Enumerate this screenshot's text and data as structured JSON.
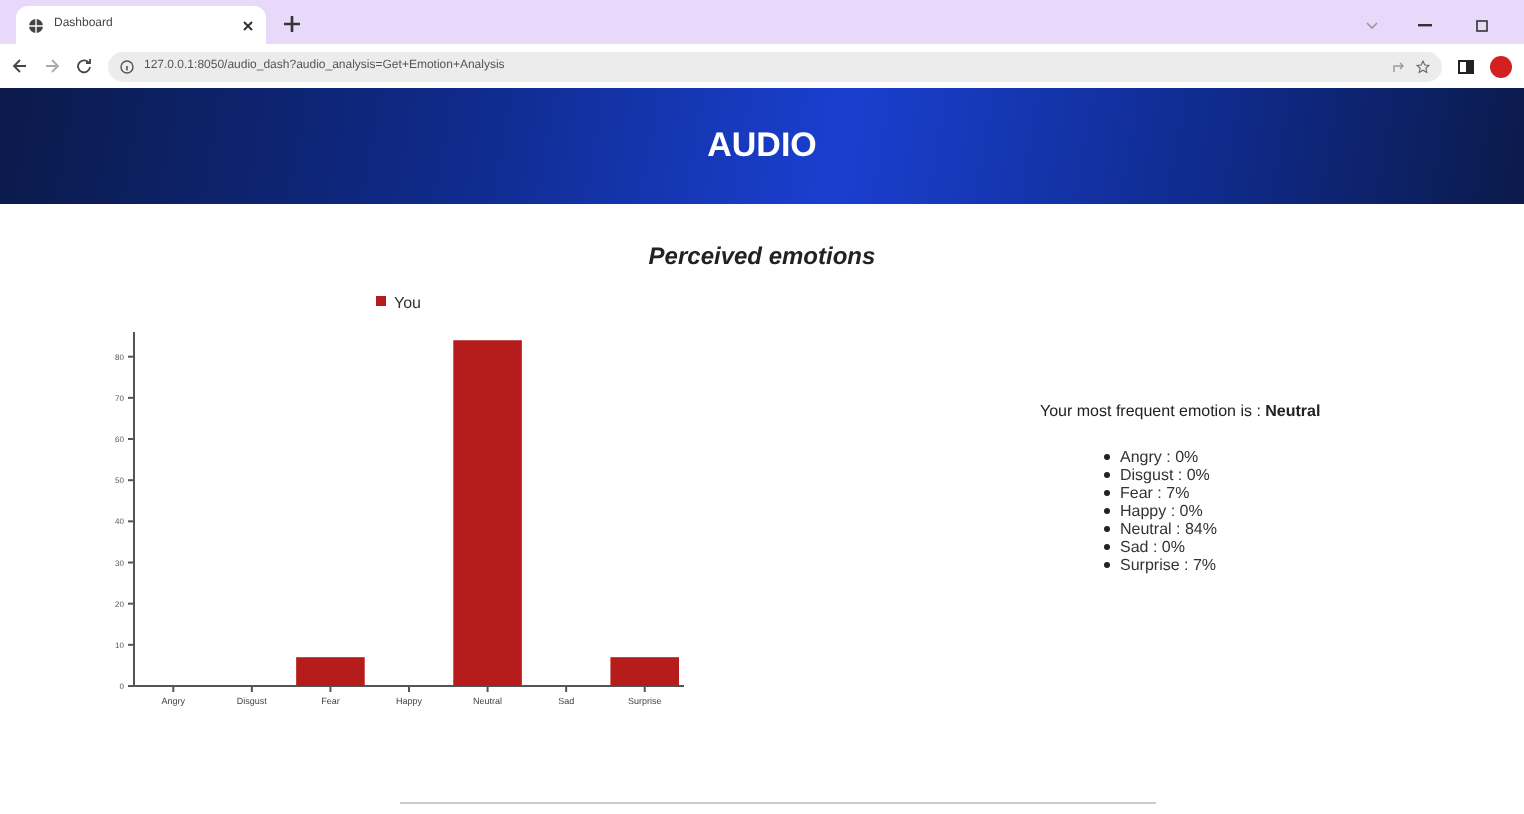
{
  "browser": {
    "tab_title": "Dashboard",
    "url": "127.0.0.1:8050/audio_dash?audio_analysis=Get+Emotion+Analysis"
  },
  "header": {
    "title": "AUDIO"
  },
  "section_title": "Perceived emotions",
  "chart_data": {
    "type": "bar",
    "categories": [
      "Angry",
      "Disgust",
      "Fear",
      "Happy",
      "Neutral",
      "Sad",
      "Surprise"
    ],
    "series": [
      {
        "name": "You",
        "color": "#b71c1c",
        "values": [
          0,
          0,
          7,
          0,
          84,
          0,
          7
        ]
      }
    ],
    "ylim": [
      0,
      86
    ],
    "yticks": [
      0,
      10,
      20,
      30,
      40,
      50,
      60,
      70,
      80
    ]
  },
  "summary": {
    "sentence": "Your most frequent emotion is : **Neutral**",
    "items": [
      "Angry : 0%",
      "Disgust : 0%",
      "Fear : 7%",
      "Happy : 0%",
      "Neutral : 84%",
      "Sad : 0%",
      "Surprise : 7%"
    ]
  }
}
